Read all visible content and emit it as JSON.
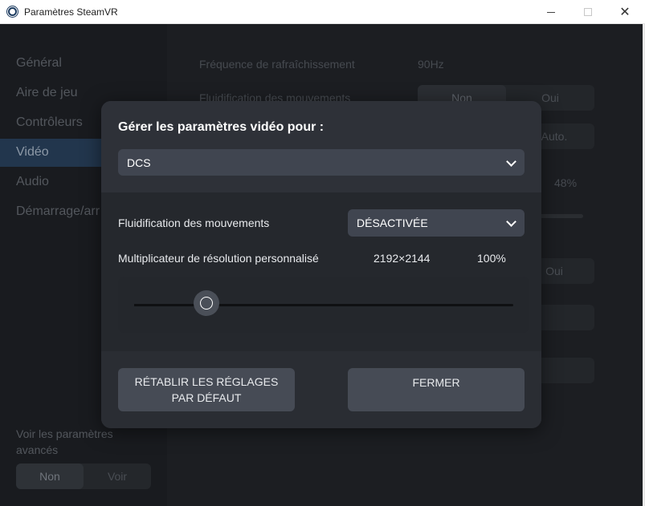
{
  "window": {
    "title": "Paramètres SteamVR"
  },
  "sidebar": {
    "items": [
      {
        "label": "Général"
      },
      {
        "label": "Aire de jeu"
      },
      {
        "label": "Contrôleurs"
      },
      {
        "label": "Vidéo",
        "active": true
      },
      {
        "label": "Audio"
      },
      {
        "label": "Démarrage/arr"
      }
    ],
    "advanced_label": "Voir les paramètres avancés",
    "advanced_toggle": {
      "off": "Non",
      "on": "Voir",
      "selected": "Non"
    }
  },
  "background": {
    "refresh_rate_label": "Fréquence de rafraîchissement",
    "refresh_rate_value": "90Hz",
    "motion_smoothing_label": "Fluidification des mouvements",
    "motion_toggle": {
      "off": "Non",
      "on": "Oui",
      "selected": "Non"
    },
    "auto_label": "Auto.",
    "percent_value": "48%",
    "oui_label": "Oui"
  },
  "modal": {
    "title": "Gérer les paramètres vidéo pour :",
    "app_selected": "DCS",
    "motion_smoothing_label": "Fluidification des mouvements",
    "motion_smoothing_value": "DÉSACTIVÉE",
    "resolution_label": "Multiplicateur de résolution personnalisé",
    "resolution_value": "2192×2144",
    "resolution_percent": "100%",
    "slider_fraction": 0.19,
    "reset_button": "RÉTABLIR LES RÉGLAGES PAR DÉFAUT",
    "close_button": "FERMER"
  },
  "colors": {
    "accent_active_nav": "#22364d",
    "modal_bg": "#2a2d33",
    "control_bg": "#404550"
  }
}
